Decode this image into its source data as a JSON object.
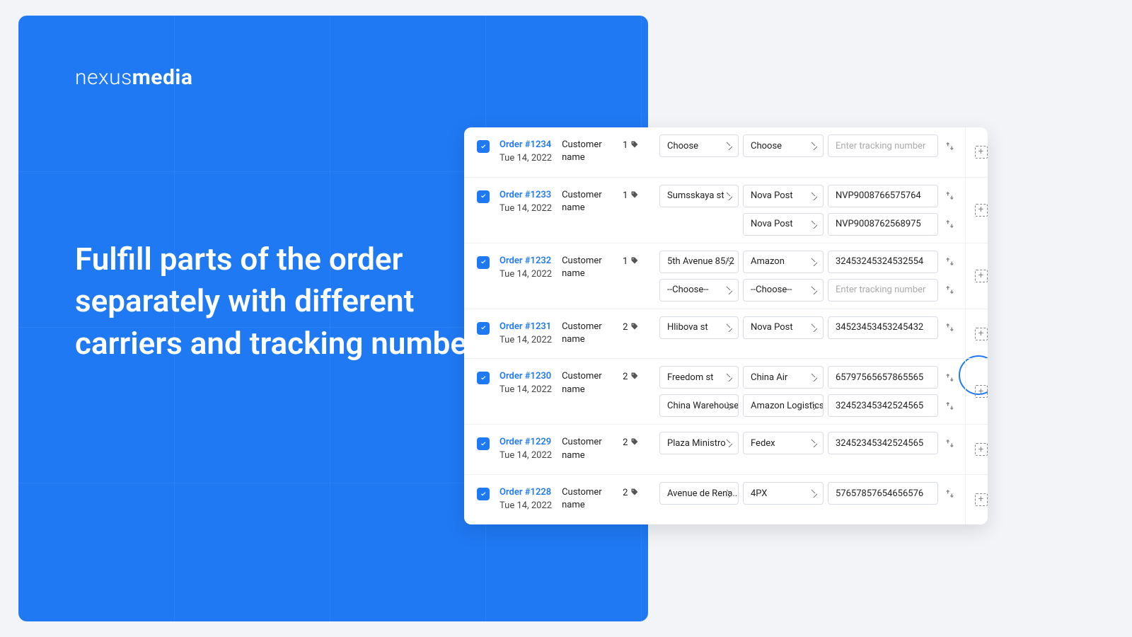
{
  "brand": {
    "light": "nexus",
    "bold": "media"
  },
  "headline": "Fulfill parts of the order separately with different carriers and tracking numbers",
  "labels": {
    "customer": "Customer name",
    "tracking_placeholder": "Enter tracking number",
    "choose": "Choose",
    "choose_dashed": "--Choose--"
  },
  "orders": [
    {
      "id": "Order #1234",
      "date": "Tue 14, 2022",
      "qty": "1",
      "lines": [
        {
          "loc": "Choose",
          "carrier": "Choose",
          "track": ""
        }
      ]
    },
    {
      "id": "Order #1233",
      "date": "Tue 14, 2022",
      "qty": "1",
      "lines": [
        {
          "loc": "Sumsskaya st",
          "carrier": "Nova Post",
          "track": "NVP9008766575764"
        },
        {
          "loc": "",
          "carrier": "Nova Post",
          "track": "NVP9008762568975"
        }
      ]
    },
    {
      "id": "Order #1232",
      "date": "Tue 14, 2022",
      "qty": "1",
      "lines": [
        {
          "loc": "5th Avenue 85/2",
          "carrier": "Amazon",
          "track": "32453245324532554"
        },
        {
          "loc": "--Choose--",
          "carrier": "--Choose--",
          "track": ""
        }
      ],
      "highlight": true
    },
    {
      "id": "Order #1231",
      "date": "Tue 14, 2022",
      "qty": "2",
      "lines": [
        {
          "loc": "Hlibova st",
          "carrier": "Nova Post",
          "track": "34523453453245432"
        }
      ]
    },
    {
      "id": "Order #1230",
      "date": "Tue 14, 2022",
      "qty": "2",
      "lines": [
        {
          "loc": "Freedom st",
          "carrier": "China Air",
          "track": "65797565657865565"
        },
        {
          "loc": "China Warehouse",
          "carrier": "Amazon Logistics",
          "track": "32452345342524565"
        }
      ]
    },
    {
      "id": "Order #1229",
      "date": "Tue 14, 2022",
      "qty": "2",
      "lines": [
        {
          "loc": "Plaza Ministro",
          "carrier": "Fedex",
          "track": "32452345342524565"
        }
      ]
    },
    {
      "id": "Order #1228",
      "date": "Tue 14, 2022",
      "qty": "2",
      "lines": [
        {
          "loc": "Avenue de Rena..",
          "carrier": "4PX",
          "track": "57657857654656576"
        }
      ]
    }
  ]
}
